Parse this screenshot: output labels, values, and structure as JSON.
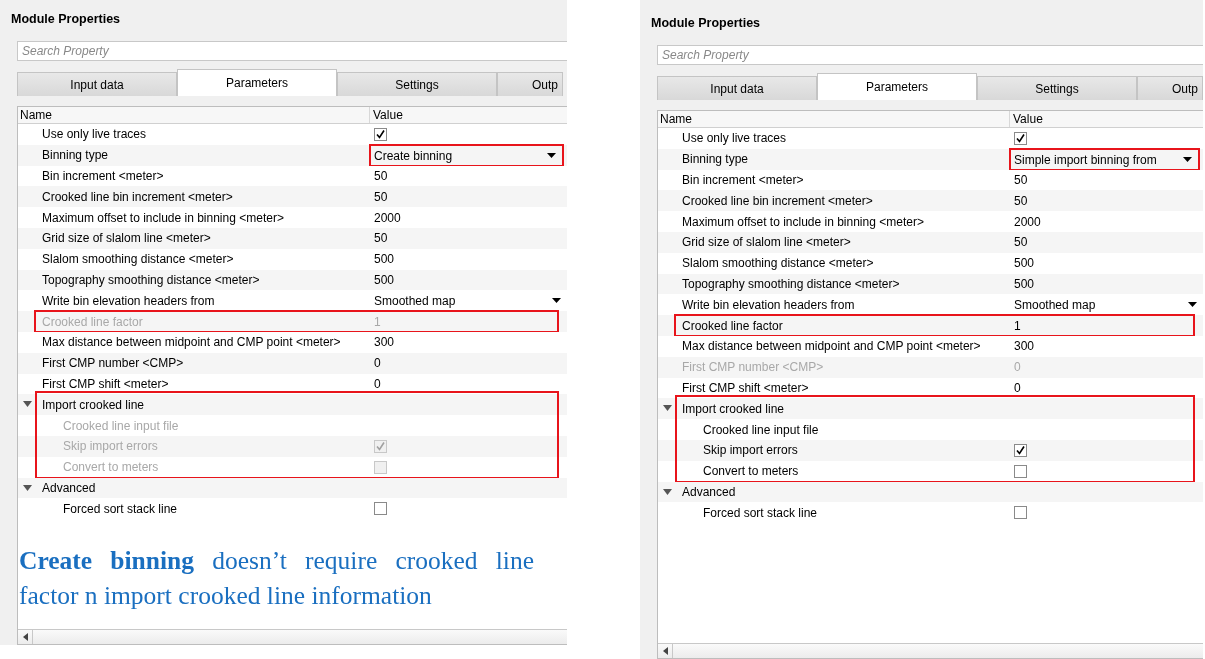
{
  "panels": [
    {
      "title": "Module Properties",
      "search": {
        "placeholder": "Search Property"
      },
      "tabs": [
        {
          "label": "Input data",
          "selected": false
        },
        {
          "label": "Parameters",
          "selected": true
        },
        {
          "label": "Settings",
          "selected": false
        },
        {
          "label": "Outp",
          "selected": false
        }
      ],
      "table": {
        "columns": [
          "Name",
          "Value"
        ],
        "rows": [
          {
            "kind": "checkbox",
            "name": "Use only live traces",
            "checked": true,
            "disabled": false,
            "highlighted": false
          },
          {
            "kind": "dropdown",
            "name": "Binning type",
            "value": "Create binning",
            "disabled": false,
            "highlighted": true
          },
          {
            "kind": "text",
            "name": "Bin increment <meter>",
            "value": "50",
            "disabled": false,
            "highlighted": false
          },
          {
            "kind": "text",
            "name": "Crooked line bin increment <meter>",
            "value": "50",
            "disabled": false,
            "highlighted": false
          },
          {
            "kind": "text",
            "name": "Maximum offset to include in binning <meter>",
            "value": "2000",
            "disabled": false,
            "highlighted": false
          },
          {
            "kind": "text",
            "name": "Grid size of slalom line <meter>",
            "value": "50",
            "disabled": false,
            "highlighted": false
          },
          {
            "kind": "text",
            "name": "Slalom smoothing distance <meter>",
            "value": "500",
            "disabled": false,
            "highlighted": false
          },
          {
            "kind": "text",
            "name": "Topography smoothing distance <meter>",
            "value": "500",
            "disabled": false,
            "highlighted": false
          },
          {
            "kind": "dropdown",
            "name": "Write bin elevation headers from",
            "value": "Smoothed map",
            "disabled": false,
            "highlighted": false
          },
          {
            "kind": "text",
            "name": "Crooked line factor",
            "value": "1",
            "disabled": true,
            "highlighted": true
          },
          {
            "kind": "text",
            "name": "Max distance between midpoint and CMP point <meter>",
            "value": "300",
            "disabled": false,
            "highlighted": false
          },
          {
            "kind": "text",
            "name": "First CMP number <CMP>",
            "value": "0",
            "disabled": false,
            "highlighted": false
          },
          {
            "kind": "text",
            "name": "First CMP shift <meter>",
            "value": "0",
            "disabled": false,
            "highlighted": false
          },
          {
            "kind": "group",
            "name": "Import crooked line",
            "expanded": true,
            "highlighted": true,
            "children": [
              {
                "kind": "text",
                "name": "Crooked line input file",
                "disabled": true,
                "highlighted": false
              },
              {
                "kind": "checkbox",
                "name": "Skip import errors",
                "checked": true,
                "disabled": true,
                "highlighted": false
              },
              {
                "kind": "checkbox",
                "name": "Convert to meters",
                "checked": false,
                "disabled": true,
                "highlighted": false
              }
            ]
          },
          {
            "kind": "group",
            "name": "Advanced",
            "expanded": true,
            "highlighted": false,
            "children": [
              {
                "kind": "checkbox",
                "name": "Forced sort stack line",
                "checked": false,
                "disabled": false,
                "highlighted": false
              }
            ]
          }
        ]
      },
      "note": "**Create binning** doesn’t require crooked line factor n import crooked line information"
    },
    {
      "title": "Module Properties",
      "search": {
        "placeholder": "Search Property"
      },
      "tabs": [
        {
          "label": "Input data",
          "selected": false
        },
        {
          "label": "Parameters",
          "selected": true
        },
        {
          "label": "Settings",
          "selected": false
        },
        {
          "label": "Outp",
          "selected": false
        }
      ],
      "table": {
        "columns": [
          "Name",
          "Value"
        ],
        "rows": [
          {
            "kind": "checkbox",
            "name": "Use only live traces",
            "checked": true,
            "disabled": false,
            "highlighted": false
          },
          {
            "kind": "dropdown",
            "name": "Binning type",
            "value": "Simple import binning from",
            "disabled": false,
            "highlighted": true
          },
          {
            "kind": "text",
            "name": "Bin increment <meter>",
            "value": "50",
            "disabled": false,
            "highlighted": false
          },
          {
            "kind": "text",
            "name": "Crooked line bin increment <meter>",
            "value": "50",
            "disabled": false,
            "highlighted": false
          },
          {
            "kind": "text",
            "name": "Maximum offset to include in binning <meter>",
            "value": "2000",
            "disabled": false,
            "highlighted": false
          },
          {
            "kind": "text",
            "name": "Grid size of slalom line <meter>",
            "value": "50",
            "disabled": false,
            "highlighted": false
          },
          {
            "kind": "text",
            "name": "Slalom smoothing distance <meter>",
            "value": "500",
            "disabled": false,
            "highlighted": false
          },
          {
            "kind": "text",
            "name": "Topography smoothing distance <meter>",
            "value": "500",
            "disabled": false,
            "highlighted": false
          },
          {
            "kind": "dropdown",
            "name": "Write bin elevation headers from",
            "value": "Smoothed map",
            "disabled": false,
            "highlighted": false
          },
          {
            "kind": "text",
            "name": "Crooked line factor",
            "value": "1",
            "disabled": false,
            "highlighted": true
          },
          {
            "kind": "text",
            "name": "Max distance between midpoint and CMP point <meter>",
            "value": "300",
            "disabled": false,
            "highlighted": false
          },
          {
            "kind": "text",
            "name": "First CMP number <CMP>",
            "value": "0",
            "disabled": true,
            "highlighted": false
          },
          {
            "kind": "text",
            "name": "First CMP shift <meter>",
            "value": "0",
            "disabled": false,
            "highlighted": false
          },
          {
            "kind": "group",
            "name": "Import crooked line",
            "expanded": true,
            "highlighted": true,
            "children": [
              {
                "kind": "text",
                "name": "Crooked line input file",
                "disabled": false,
                "highlighted": false
              },
              {
                "kind": "checkbox",
                "name": "Skip import errors",
                "checked": true,
                "disabled": false,
                "highlighted": false
              },
              {
                "kind": "checkbox",
                "name": "Convert to meters",
                "checked": false,
                "disabled": false,
                "highlighted": false
              }
            ]
          },
          {
            "kind": "group",
            "name": "Advanced",
            "expanded": true,
            "highlighted": false,
            "children": [
              {
                "kind": "checkbox",
                "name": "Forced sort stack line",
                "checked": false,
                "disabled": false,
                "highlighted": false
              }
            ]
          }
        ]
      }
    }
  ]
}
